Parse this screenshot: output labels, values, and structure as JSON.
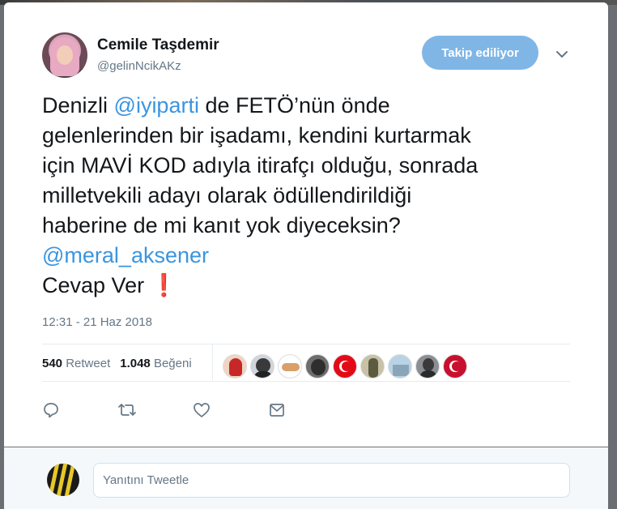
{
  "user": {
    "name": "Cemile Taşdemir",
    "handle": "@gelinNcikAKz",
    "follow_label": "Takip ediliyor"
  },
  "tweet": {
    "lines": [
      {
        "pre": "Denizli ",
        "mention": "@iyiparti",
        "post": " de FETÖ’nün önde"
      },
      {
        "text": "gelenlerinden bir işadamı, kendini kurtarmak"
      },
      {
        "text": "için MAVİ KOD adıyla itirafçı olduğu, sonrada"
      },
      {
        "text": "milletvekili adayı olarak ödüllendirildiği"
      },
      {
        "text": "haberine de mi kanıt yok diyeceksin?"
      },
      {
        "mention": "@meral_aksener"
      },
      {
        "text": "Cevap Ver ",
        "emoji": "❗"
      }
    ],
    "timestamp": "12:31 - 21 Haz 2018"
  },
  "stats": {
    "retweets_count": "540",
    "retweets_label": "Retweet",
    "likes_count": "1.048",
    "likes_label": "Beğeni"
  },
  "likers": [
    {
      "icon": "avatar-red-hand",
      "color": "#c62828"
    },
    {
      "icon": "avatar-man-glasses",
      "color": "#333333"
    },
    {
      "icon": "avatar-handshake",
      "color": "#d9b48f"
    },
    {
      "icon": "avatar-dark-photo",
      "color": "#444444"
    },
    {
      "icon": "avatar-turkish-flag",
      "color": "#e30a17"
    },
    {
      "icon": "avatar-soldier",
      "color": "#6b6b4e"
    },
    {
      "icon": "avatar-building",
      "color": "#9bb7cf"
    },
    {
      "icon": "avatar-man-dark",
      "color": "#3a3a3a"
    },
    {
      "icon": "avatar-turkish-flag-2",
      "color": "#c8102e"
    }
  ],
  "actions": [
    "reply-icon",
    "retweet-icon",
    "like-icon",
    "dm-icon"
  ],
  "reply": {
    "placeholder": "Yanıtını Tweetle"
  },
  "colors": {
    "accent": "#1da1f2",
    "follow_button": "#7fb6e6",
    "mention": "#3a95e0",
    "exclaim": "#c0182d"
  }
}
